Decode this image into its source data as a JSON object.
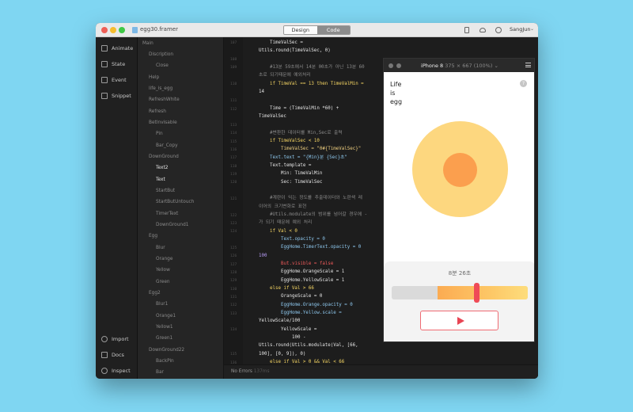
{
  "window": {
    "title": "egg30.framer",
    "mode_design": "Design",
    "mode_code": "Code",
    "user": "SangJun"
  },
  "tools": {
    "animate": "Animate",
    "state": "State",
    "event": "Event",
    "snippet": "Snippet",
    "import": "Import",
    "docs": "Docs",
    "inspect": "Inspect"
  },
  "layers": [
    "Main",
    "Discription",
    "Close",
    "Help",
    "life_is_egg",
    "RefreshWhite",
    "Refresh",
    "BetInvisable",
    "Pin",
    "Bar_Copy",
    "DownGround",
    "Text2",
    "Text",
    "StartBut",
    "StartButUntouch",
    "TimerText",
    "DownGround1",
    "Egg",
    "Blur",
    "Orange",
    "Yellow",
    "Green",
    "Egg2",
    "Blur1",
    "Orange1",
    "Yellow1",
    "Green1",
    "DownGround22",
    "BackPin",
    "Bar"
  ],
  "editor": {
    "line_numbers": [
      "107",
      "108",
      "109",
      "110",
      "111",
      "112",
      "113",
      "114",
      "115",
      "116",
      "117",
      "118",
      "119",
      "120",
      "121",
      "122",
      "123",
      "124",
      "125",
      "126",
      "127",
      "128",
      "129",
      "130",
      "131",
      "132",
      "133",
      "134",
      "135",
      "136"
    ],
    "code": [
      "TimeValSec =",
      "Utils.round(TimeValSec, 0)",
      "#13분 59초에서 14분 00초가 아닌 13분 60",
      "초로 되기때문에 예외처리",
      "if TimeVal == 13 then TimeValMin =",
      "14",
      "Time = (TimeValMin *60) +",
      "TimeValSec",
      "#변환한 데이터를 Min,Sec로 출력",
      "if TimeValSec < 10",
      "TimeValSec = \"0#{TimeValSec}\"",
      "Text.text = \"{Min}분 {Sec}초\"",
      "Text.template =",
      "Min: TimeValMin",
      "Sec: TimeValSec",
      "#계란이 익는 정도를 추출데이터와 노란색 레",
      "이어의 크기변화로 표현",
      "#Utils.modulate의 범위를 넘어갈 경우에 -",
      "가 되기 때문에 예외 처리",
      "if Val < 0",
      "Text.opacity = 0",
      "EggHome.TimerText.opacity = 0",
      "100",
      "But.visible = false",
      "EggHome.OrangeScale = 1",
      "EggHome.YellowScale = 1",
      "else if Val > 66",
      "OrangeScale = 0",
      "EggHome.Orange.opacity = 0",
      "EggHome.Yellow.scale =",
      "YellowScale/100",
      "YellowScale =",
      "100 -",
      "Utils.round(Utils.modulate(Val, [66,",
      "100], [0, 9]), 0)",
      "else if Val > 0 && Val < 66"
    ],
    "status": "No Errors",
    "status_time": "137ms"
  },
  "preview": {
    "device": "iPhone 8",
    "resolution": "375 × 667 (100%)",
    "life_lines": [
      "Life",
      "is",
      "egg"
    ],
    "help": "?",
    "timer": "8분 26초",
    "progress_fraction": 0.62
  },
  "colors": {
    "egg_white": "#fdd77f",
    "yolk": "#fb9f4e",
    "accent_red": "#ef4b57",
    "keyword": "#f6d663",
    "number": "#b79cf5"
  }
}
